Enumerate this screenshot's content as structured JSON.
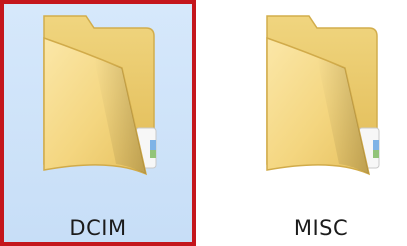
{
  "folders": [
    {
      "name": "DCIM",
      "selected": true
    },
    {
      "name": "MISC",
      "selected": false
    }
  ],
  "colors": {
    "selection_background": "#cfe3f9",
    "selection_border": "#c4161c",
    "folder_yellow": "#f3d98a",
    "label_text": "#1b1b1b"
  },
  "icons": [
    "folder-icon",
    "folder-icon"
  ]
}
